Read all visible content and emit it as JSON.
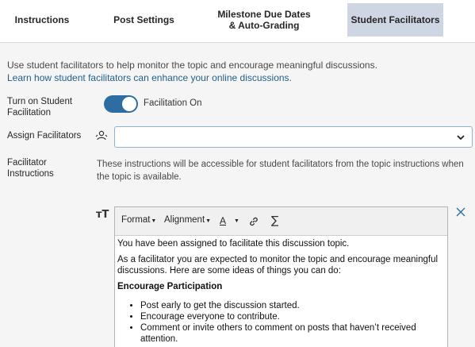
{
  "tabs": [
    {
      "label": "Instructions"
    },
    {
      "label": "Post Settings"
    },
    {
      "label": "Milestone Due Dates & Auto-Grading"
    },
    {
      "label": "Student Facilitators"
    }
  ],
  "intro": {
    "description": "Use student facilitators to help monitor the topic and encourage meaningful discussions.",
    "link_text": "Learn how student facilitators can enhance your online discussions."
  },
  "facilitation": {
    "label": "Turn on Student Facilitation",
    "toggle_on": true,
    "status_text": "Facilitation On"
  },
  "assign": {
    "label": "Assign Facilitators",
    "selected_value": ""
  },
  "instructions": {
    "label": "Facilitator Instructions",
    "description": "These instructions will be accessible for student facilitators from the topic instructions when the topic is available."
  },
  "editor": {
    "toolbar": {
      "format": "Format",
      "alignment": "Alignment",
      "font_color": "A",
      "math": "∑"
    },
    "content": {
      "p1": "You have been assigned to facilitate this discussion topic.",
      "p2": "As a facilitator you are expected to monitor the topic and encourage meaningful discussions. Here are some ideas of things you can do:",
      "heading": "Encourage Participation",
      "bullets": [
        "Post early to get the discussion started.",
        "Encourage everyone to contribute.",
        "Comment or invite others to comment on posts that haven’t received attention."
      ]
    }
  },
  "colors": {
    "active_tab": "#cfd6e3",
    "toggle": "#2d6da3",
    "link": "#1f5f8b",
    "close_icon": "#2d6da3"
  }
}
